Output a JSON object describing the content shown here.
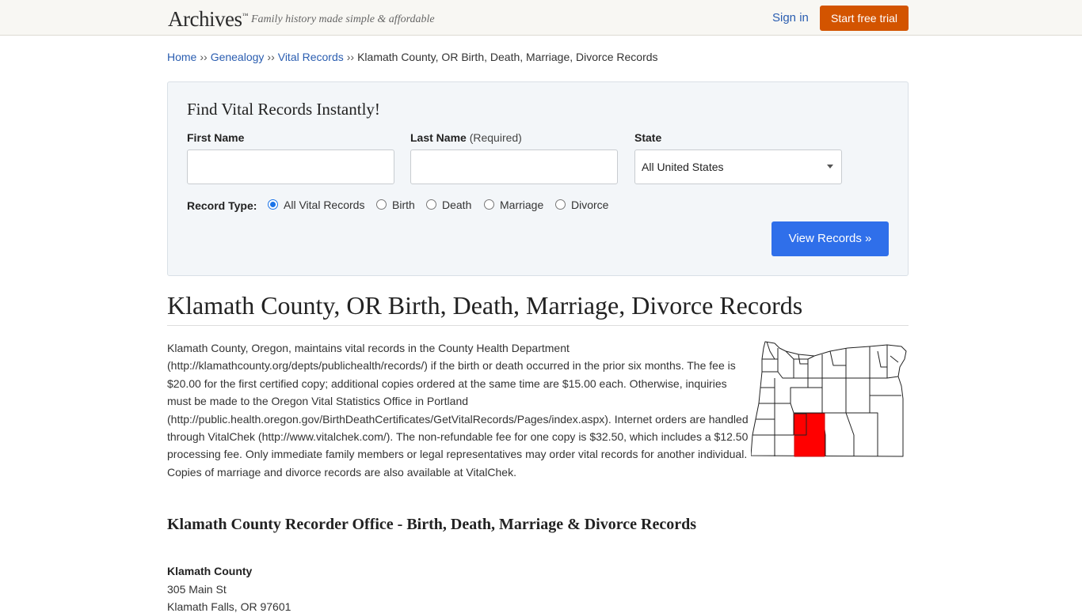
{
  "header": {
    "logo": "Archives",
    "logo_tm": "™",
    "tagline": "Family history made simple & affordable",
    "signin_label": "Sign in",
    "trial_label": "Start free trial"
  },
  "breadcrumb": {
    "items": [
      "Home",
      "Genealogy",
      "Vital Records"
    ],
    "current": "Klamath County, OR Birth, Death, Marriage, Divorce Records",
    "separator": "››"
  },
  "search": {
    "title": "Find Vital Records Instantly!",
    "first_name_label": "First Name",
    "last_name_label": "Last Name",
    "last_name_hint": "(Required)",
    "state_label": "State",
    "first_name_value": "",
    "last_name_value": "",
    "state_value": "All United States",
    "record_type_label": "Record Type:",
    "record_types": [
      "All Vital Records",
      "Birth",
      "Death",
      "Marriage",
      "Divorce"
    ],
    "selected_record_type": "All Vital Records",
    "submit_label": "View Records »"
  },
  "content": {
    "title": "Klamath County, OR Birth, Death, Marriage, Divorce Records",
    "paragraph": "Klamath County, Oregon, maintains vital records in the County Health Department (http://klamathcounty.org/depts/publichealth/records/) if the birth or death occurred in the prior six months. The fee is $20.00 for the first certified copy; additional copies ordered at the same time are $15.00 each. Otherwise, inquiries must be made to the Oregon Vital Statistics Office in Portland (http://public.health.oregon.gov/BirthDeathCertificates/GetVitalRecords/Pages/index.aspx). Internet orders are handled through VitalChek (http://www.vitalchek.com/). The non-refundable fee for one copy is $32.50, which includes a $12.50 processing fee. Only immediate family members or legal representatives may order vital records for another individual. Copies of marriage and divorce records are also available at VitalChek.",
    "subtitle": "Klamath County Recorder Office - Birth, Death, Marriage & Divorce Records",
    "office_name": "Klamath County",
    "office_address": [
      "305 Main St",
      "Klamath Falls, OR 97601"
    ]
  },
  "colors": {
    "accent_orange": "#d35400",
    "link_blue": "#2a5db0",
    "button_blue": "#2f6fea",
    "map_highlight": "#ff0000"
  }
}
